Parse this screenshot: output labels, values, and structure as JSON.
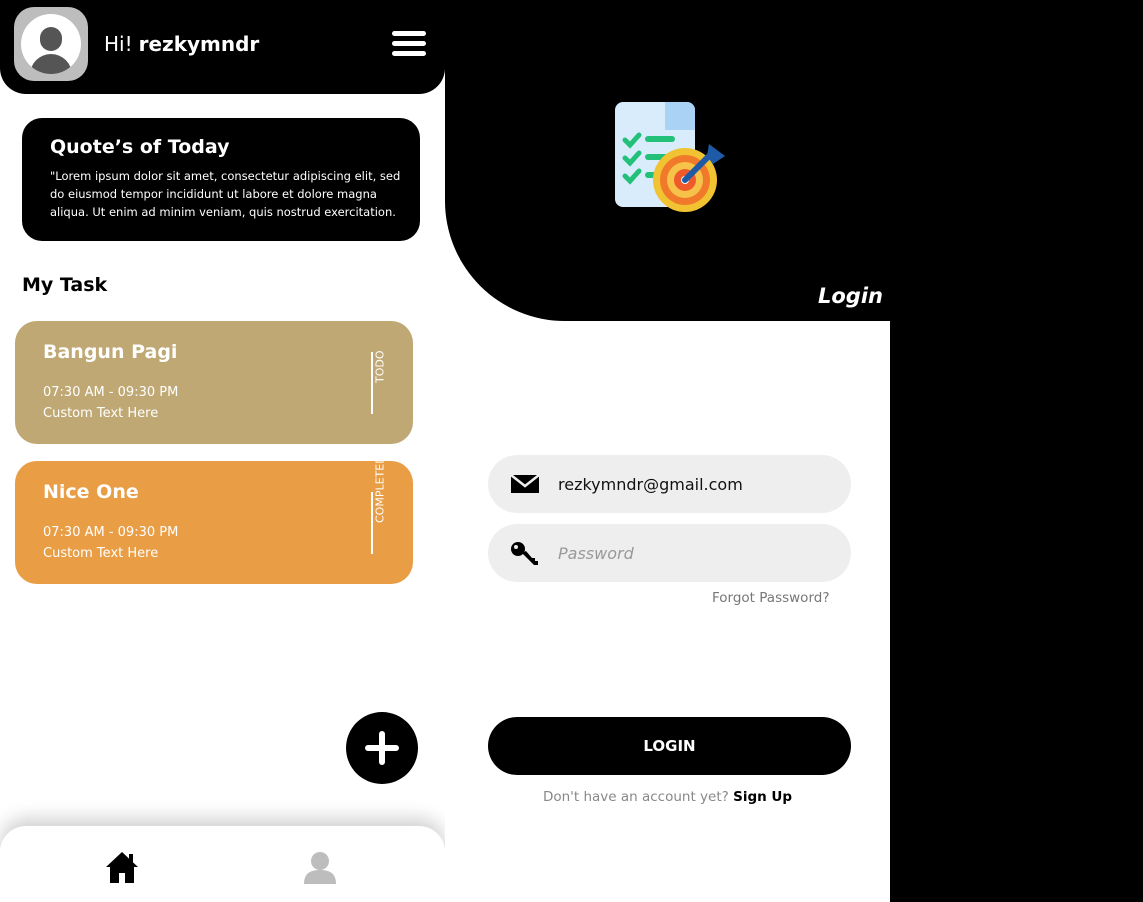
{
  "home": {
    "greeting_prefix": "Hi!",
    "username": "rezkymndr",
    "quote": {
      "title": "Quote’s of Today",
      "text": "\"Lorem ipsum dolor sit amet, consectetur adipiscing elit, sed do eiusmod tempor incididunt ut labore et dolore magna aliqua. Ut enim ad minim veniam, quis nostrud exercitation."
    },
    "section_title": "My Task",
    "tasks": [
      {
        "title": "Bangun Pagi",
        "time": "07:30 AM - 09:30 PM",
        "note": "Custom Text Here",
        "status": "TODO",
        "color": "#BFA873"
      },
      {
        "title": "Nice One",
        "time": "07:30 AM - 09:30 PM",
        "note": "Custom Text Here",
        "status": "COMPLETED",
        "color": "#E99D45"
      }
    ],
    "nav": {
      "home_icon": "home-icon",
      "profile_icon": "user-icon"
    }
  },
  "login": {
    "title": "Login",
    "email_value": "rezkymndr@gmail.com",
    "password_placeholder": "Password",
    "forgot_label": "Forgot Password?",
    "login_button": "LOGIN",
    "signup_prompt": "Don't have an account yet?",
    "signup_link": "Sign Up"
  }
}
